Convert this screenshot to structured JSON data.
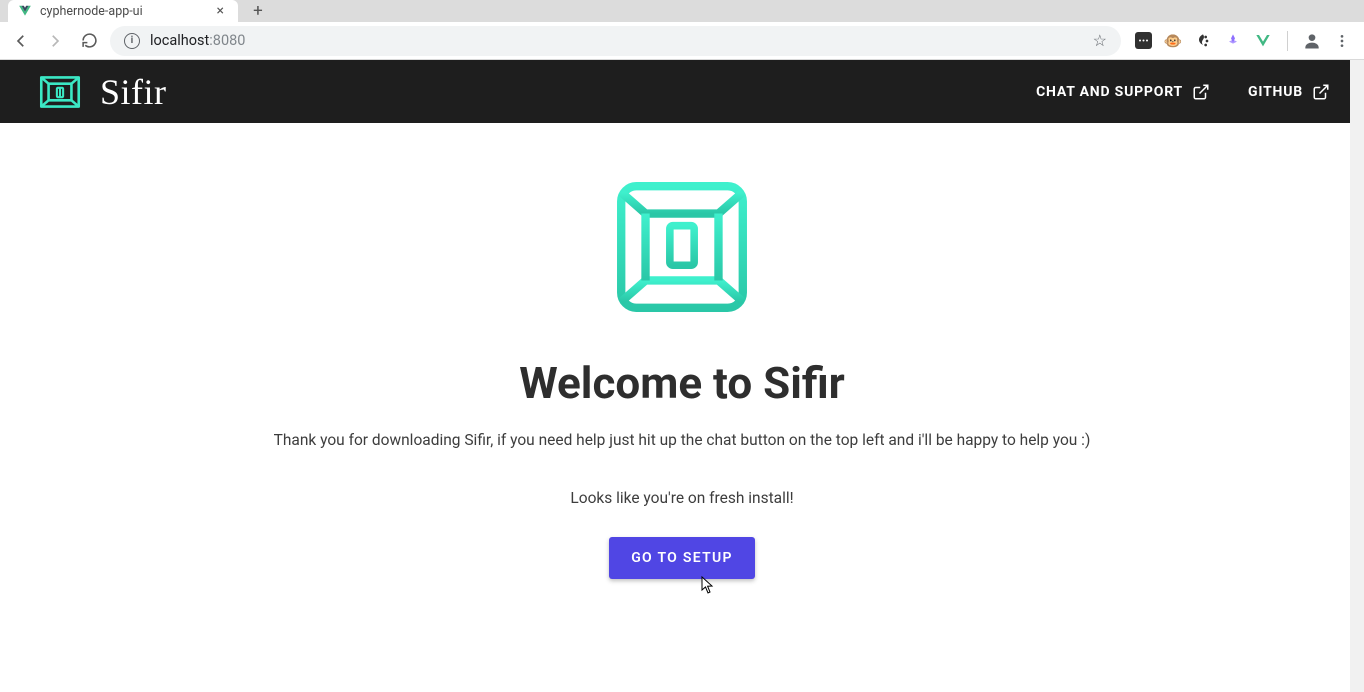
{
  "browser": {
    "tab_title": "cyphernode-app-ui",
    "url_host": "localhost",
    "url_port": ":8080"
  },
  "header": {
    "brand": "Sifir",
    "links": {
      "chat": "CHAT AND SUPPORT",
      "github": "GITHUB"
    }
  },
  "hero": {
    "title": "Welcome to Sifir",
    "subtitle": "Thank you for downloading Sifir, if you need help just hit up the chat button on the top left and i'll be happy to help you :)",
    "status": "Looks like you're on fresh install!",
    "cta": "GO TO SETUP"
  },
  "colors": {
    "logo_accent": "#3be8c5",
    "cta_bg": "#5046e4",
    "header_bg": "#1e1e1e"
  }
}
